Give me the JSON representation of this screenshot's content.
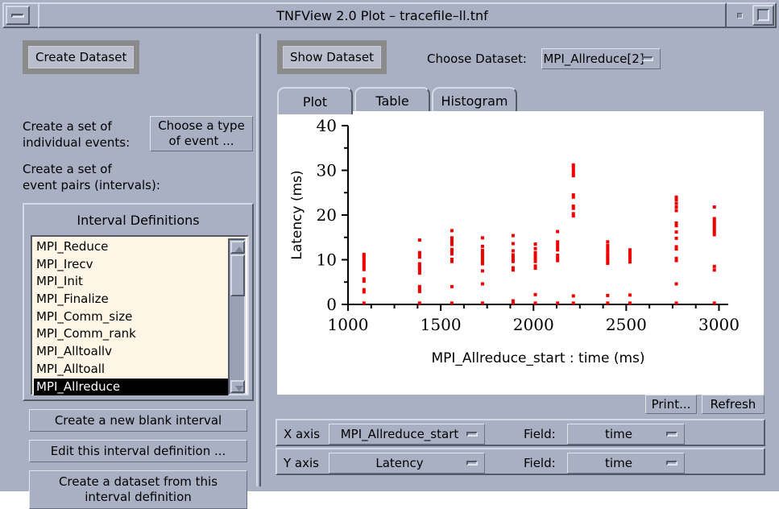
{
  "window": {
    "title": "TNFView 2.0 Plot – tracefile–ll.tnf",
    "minimize_icon": "window-minimize-icon",
    "menu_icon": "window-menu-icon",
    "maximize_icon": "window-maximize-icon"
  },
  "left_panel": {
    "header": "Create Dataset",
    "individual_events_label": "Create a set of\nindividual events:",
    "choose_event_button": "Choose a type\nof event ...",
    "event_pairs_label": "Create a set of\nevent pairs (intervals):",
    "interval_group_title": "Interval Definitions",
    "intervals": [
      {
        "label": "MPI_Reduce",
        "selected": false
      },
      {
        "label": "MPI_Irecv",
        "selected": false
      },
      {
        "label": "MPI_Init",
        "selected": false
      },
      {
        "label": "MPI_Finalize",
        "selected": false
      },
      {
        "label": "MPI_Comm_size",
        "selected": false
      },
      {
        "label": "MPI_Comm_rank",
        "selected": false
      },
      {
        "label": "MPI_Alltoallv",
        "selected": false
      },
      {
        "label": "MPI_Alltoall",
        "selected": false
      },
      {
        "label": "MPI_Allreduce",
        "selected": true
      }
    ],
    "buttons": {
      "new_blank": "Create a new blank interval",
      "edit": "Edit this interval definition ...",
      "create_dataset": "Create a dataset from this\ninterval definition"
    }
  },
  "right_panel": {
    "header": "Show Dataset",
    "choose_dataset_label": "Choose Dataset:",
    "choose_dataset_value": "MPI_Allreduce[2]",
    "tabs": [
      {
        "label": "Plot",
        "active": true
      },
      {
        "label": "Table",
        "active": false
      },
      {
        "label": "Histogram",
        "active": false
      }
    ],
    "plot_buttons": {
      "print": "Print...",
      "refresh": "Refresh"
    },
    "axis_controls": [
      {
        "axis_label": "X axis",
        "axis_value": "MPI_Allreduce_start",
        "field_label": "Field:",
        "field_value": "time"
      },
      {
        "axis_label": "Y axis",
        "axis_value": "Latency",
        "field_label": "Field:",
        "field_value": "time"
      }
    ]
  },
  "chart_data": {
    "type": "scatter",
    "title": "",
    "xlabel": "MPI_Allreduce_start : time (ms)",
    "ylabel": "Latency (ms)",
    "xlim": [
      1000,
      3050
    ],
    "ylim": [
      0,
      40
    ],
    "xticks": [
      1000,
      1500,
      2000,
      2500,
      3000
    ],
    "xticks_minor": [
      1125,
      1250,
      1375,
      1625,
      1750,
      1875,
      2125,
      2250,
      2375,
      2625,
      2750,
      2875
    ],
    "yticks": [
      0,
      10,
      20,
      30,
      40
    ],
    "yticks_minor": [
      5,
      15,
      25,
      35
    ],
    "grid": false,
    "legend": false,
    "marker_color": "#ee0000",
    "marker_size": 4,
    "points": [
      [
        1086,
        0.3
      ],
      [
        1086,
        2.8
      ],
      [
        1086,
        3.3
      ],
      [
        1086,
        5.2
      ],
      [
        1086,
        5.7
      ],
      [
        1086,
        7.8
      ],
      [
        1086,
        8.3
      ],
      [
        1086,
        8.8
      ],
      [
        1086,
        9.3
      ],
      [
        1086,
        9.8
      ],
      [
        1086,
        10.3
      ],
      [
        1086,
        10.8
      ],
      [
        1086,
        11.2
      ],
      [
        1386,
        0.3
      ],
      [
        1386,
        2.9
      ],
      [
        1386,
        3.4
      ],
      [
        1386,
        4.0
      ],
      [
        1386,
        7.0
      ],
      [
        1386,
        7.6
      ],
      [
        1386,
        8.1
      ],
      [
        1386,
        8.6
      ],
      [
        1386,
        9.1
      ],
      [
        1386,
        10.6
      ],
      [
        1386,
        11.1
      ],
      [
        1386,
        11.6
      ],
      [
        1386,
        14.4
      ],
      [
        1560,
        0.3
      ],
      [
        1560,
        4.0
      ],
      [
        1560,
        9.6
      ],
      [
        1560,
        10.1
      ],
      [
        1560,
        11.3
      ],
      [
        1560,
        11.8
      ],
      [
        1560,
        12.3
      ],
      [
        1560,
        13.4
      ],
      [
        1560,
        13.9
      ],
      [
        1560,
        14.4
      ],
      [
        1560,
        14.9
      ],
      [
        1560,
        16.5
      ],
      [
        1725,
        0.3
      ],
      [
        1725,
        4.6
      ],
      [
        1725,
        7.5
      ],
      [
        1725,
        9.1
      ],
      [
        1725,
        9.6
      ],
      [
        1725,
        10.1
      ],
      [
        1725,
        10.6
      ],
      [
        1725,
        11.1
      ],
      [
        1725,
        11.6
      ],
      [
        1725,
        12.1
      ],
      [
        1725,
        13.0
      ],
      [
        1725,
        14.9
      ],
      [
        1890,
        0.3
      ],
      [
        1890,
        0.8
      ],
      [
        1890,
        7.7
      ],
      [
        1890,
        8.2
      ],
      [
        1890,
        9.6
      ],
      [
        1890,
        10.1
      ],
      [
        1890,
        10.6
      ],
      [
        1890,
        11.1
      ],
      [
        1890,
        12.0
      ],
      [
        1890,
        13.6
      ],
      [
        1890,
        15.4
      ],
      [
        2010,
        0.3
      ],
      [
        2010,
        2.2
      ],
      [
        2010,
        8.1
      ],
      [
        2010,
        8.6
      ],
      [
        2010,
        9.6
      ],
      [
        2010,
        10.1
      ],
      [
        2010,
        10.6
      ],
      [
        2010,
        11.1
      ],
      [
        2010,
        11.6
      ],
      [
        2010,
        12.5
      ],
      [
        2010,
        13.5
      ],
      [
        2130,
        0.3
      ],
      [
        2130,
        9.8
      ],
      [
        2130,
        10.3
      ],
      [
        2130,
        11.0
      ],
      [
        2130,
        12.2
      ],
      [
        2130,
        12.7
      ],
      [
        2130,
        13.4
      ],
      [
        2130,
        14.0
      ],
      [
        2130,
        16.3
      ],
      [
        2215,
        0.3
      ],
      [
        2215,
        1.9
      ],
      [
        2215,
        19.8
      ],
      [
        2215,
        20.3
      ],
      [
        2215,
        21.5
      ],
      [
        2215,
        22.0
      ],
      [
        2215,
        24.0
      ],
      [
        2215,
        24.5
      ],
      [
        2215,
        28.8
      ],
      [
        2215,
        29.4
      ],
      [
        2215,
        30.0
      ],
      [
        2215,
        30.6
      ],
      [
        2215,
        31.2
      ],
      [
        2400,
        0.3
      ],
      [
        2400,
        2.0
      ],
      [
        2400,
        9.2
      ],
      [
        2400,
        9.7
      ],
      [
        2400,
        10.3
      ],
      [
        2400,
        10.8
      ],
      [
        2400,
        11.3
      ],
      [
        2400,
        12.0
      ],
      [
        2400,
        12.6
      ],
      [
        2400,
        13.2
      ],
      [
        2400,
        14.0
      ],
      [
        2520,
        0.3
      ],
      [
        2520,
        2.1
      ],
      [
        2520,
        9.5
      ],
      [
        2520,
        10.2
      ],
      [
        2520,
        10.7
      ],
      [
        2520,
        11.2
      ],
      [
        2520,
        11.7
      ],
      [
        2520,
        12.2
      ],
      [
        2770,
        0.3
      ],
      [
        2770,
        4.6
      ],
      [
        2770,
        9.8
      ],
      [
        2770,
        10.3
      ],
      [
        2770,
        12.4
      ],
      [
        2770,
        12.9
      ],
      [
        2770,
        14.8
      ],
      [
        2770,
        16.2
      ],
      [
        2770,
        17.6
      ],
      [
        2770,
        18.2
      ],
      [
        2770,
        21.0
      ],
      [
        2770,
        21.8
      ],
      [
        2770,
        22.6
      ],
      [
        2770,
        23.4
      ],
      [
        2770,
        24.0
      ],
      [
        2975,
        0.3
      ],
      [
        2975,
        7.7
      ],
      [
        2975,
        8.5
      ],
      [
        2975,
        15.6
      ],
      [
        2975,
        16.2
      ],
      [
        2975,
        16.8
      ],
      [
        2975,
        17.4
      ],
      [
        2975,
        18.0
      ],
      [
        2975,
        18.6
      ],
      [
        2975,
        19.2
      ],
      [
        2975,
        21.8
      ]
    ]
  }
}
